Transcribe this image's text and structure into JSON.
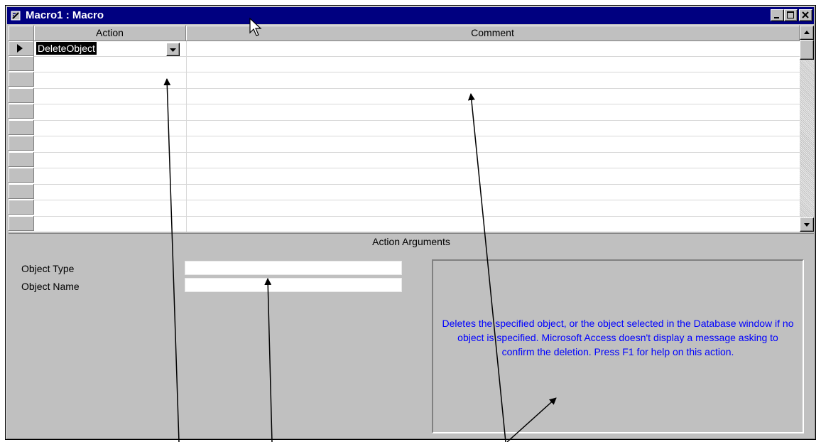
{
  "window": {
    "title": "Macro1 : Macro"
  },
  "grid": {
    "columns": [
      "Action",
      "Comment"
    ],
    "rows": [
      {
        "action": "DeleteObject",
        "comment": ""
      }
    ]
  },
  "action_arguments": {
    "header": "Action Arguments",
    "fields": [
      {
        "label": "Object Type",
        "value": ""
      },
      {
        "label": "Object Name",
        "value": ""
      }
    ],
    "help_text": "Deletes the specified object, or the object selected in the Database window if no object is specified. Microsoft Access doesn't display a message asking to confirm the deletion. Press F1 for help on this action."
  },
  "colors": {
    "title_bar": "#000080",
    "window_face": "#c0c0c0",
    "help_text": "#0000ff"
  }
}
